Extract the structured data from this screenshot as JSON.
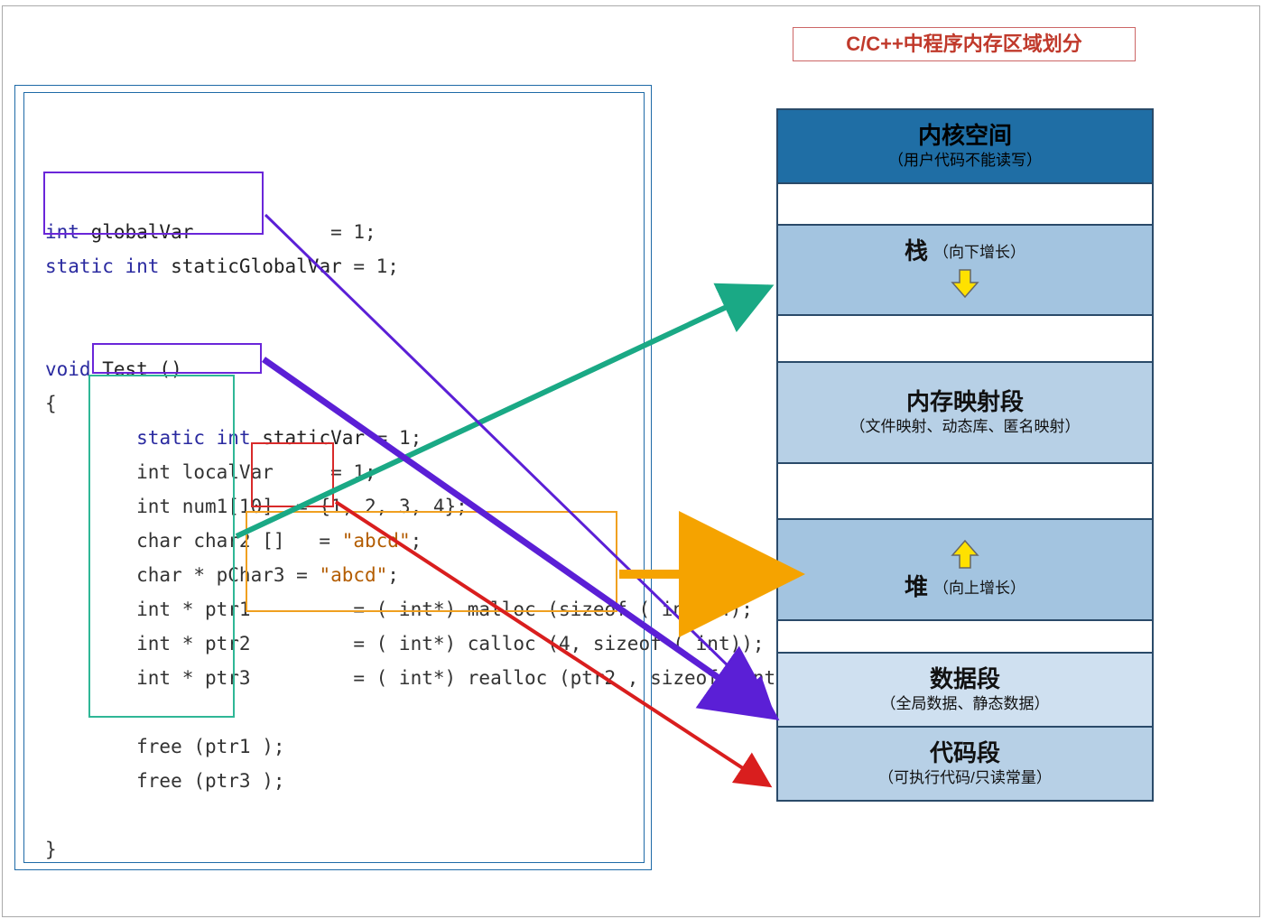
{
  "title": "C/C++中程序内存区域划分",
  "code": {
    "global1_kw": "int ",
    "global1_nm": "globalVar",
    "global1_rest": "            = 1;",
    "global2_kw": "static int ",
    "global2_nm": "staticGlobalVar",
    "global2_rest": " = 1;",
    "func_kw": "void ",
    "func_nm": "Test ()",
    "brace_open": "{",
    "static_kw": "static int ",
    "static_nm": "staticVar",
    "static_rest": " = 1;",
    "local1": "        int localVar     = 1;",
    "local2": "        int num1[10]  = {1, 2, 3, 4};",
    "local3a": "        char char2 []   = ",
    "local3b": "\"abcd\"",
    "local3c": ";",
    "local4a": "        char * pChar3 = ",
    "local4b": "\"abcd\"",
    "local4c": ";",
    "ptr1": "        int * ptr1         = ( int*) malloc (sizeof ( int)*4);",
    "ptr2": "        int * ptr2         = ( int*) calloc (4, sizeof ( int));",
    "ptr3": "        int * ptr3         = ( int*) realloc (ptr2 , sizeof( int )*4);",
    "blank": "",
    "free1": "        free (ptr1 );",
    "free2": "        free (ptr3 );",
    "brace_close": "}"
  },
  "mem": {
    "kernel_t": "内核空间",
    "kernel_s": "（用户代码不能读写）",
    "stack_t": "栈",
    "stack_s": "（向下增长）",
    "mmap_t": "内存映射段",
    "mmap_s": "（文件映射、动态库、匿名映射）",
    "heap_t": "堆",
    "heap_s": "（向上增长）",
    "data_t": "数据段",
    "data_s": "（全局数据、静态数据）",
    "code_t": "代码段",
    "code_s": "（可执行代码/只读常量）"
  }
}
